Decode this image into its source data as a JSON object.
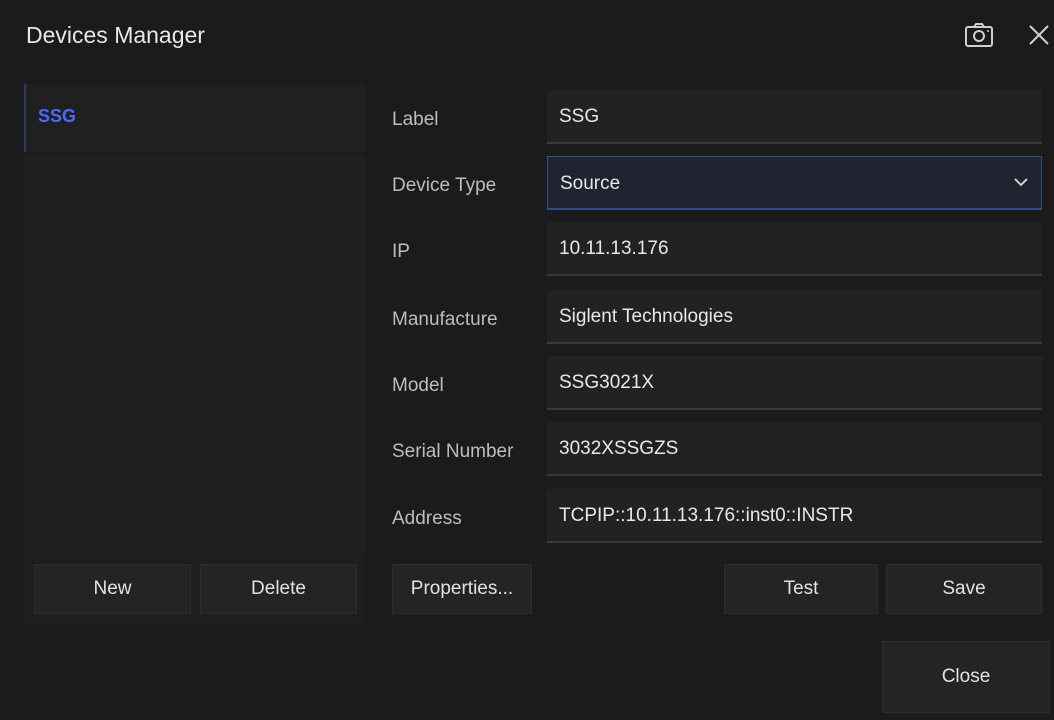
{
  "window": {
    "title": "Devices Manager"
  },
  "devices": [
    {
      "label": "SSG"
    }
  ],
  "form": {
    "label": {
      "caption": "Label",
      "value": "SSG"
    },
    "device_type": {
      "caption": "Device Type",
      "value": "Source"
    },
    "ip": {
      "caption": "IP",
      "value": "10.11.13.176"
    },
    "manufacture": {
      "caption": "Manufacture",
      "value": "Siglent Technologies"
    },
    "model": {
      "caption": "Model",
      "value": "SSG3021X"
    },
    "serial": {
      "caption": "Serial Number",
      "value": "3032XSSGZS"
    },
    "address": {
      "caption": "Address",
      "value": "TCPIP::10.11.13.176::inst0::INSTR"
    }
  },
  "buttons": {
    "new": "New",
    "delete": "Delete",
    "properties": "Properties...",
    "test": "Test",
    "save": "Save",
    "close": "Close"
  },
  "icons": {
    "camera": "camera-icon",
    "close": "close-icon",
    "dropdown": "chevron-down-icon"
  },
  "colors": {
    "background": "#1b1b1b",
    "accent": "#4a6bff",
    "select_border": "#2f4f8a"
  }
}
